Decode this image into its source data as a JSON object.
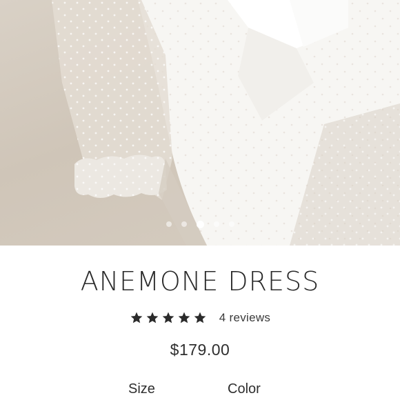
{
  "product": {
    "image_alt": "White dress with polka-dot sheer sleeves and bow",
    "gallery": {
      "total": 5,
      "active_index": 2
    },
    "title": "ANEMONE DRESS",
    "rating": {
      "stars": 5,
      "reviews_label": "4 reviews"
    },
    "price": "$179.00",
    "options": {
      "size_label": "Size",
      "color_label": "Color"
    }
  },
  "colors": {
    "background": "#ffffff",
    "text": "#2b2b2b",
    "star": "#2b2b2b"
  }
}
